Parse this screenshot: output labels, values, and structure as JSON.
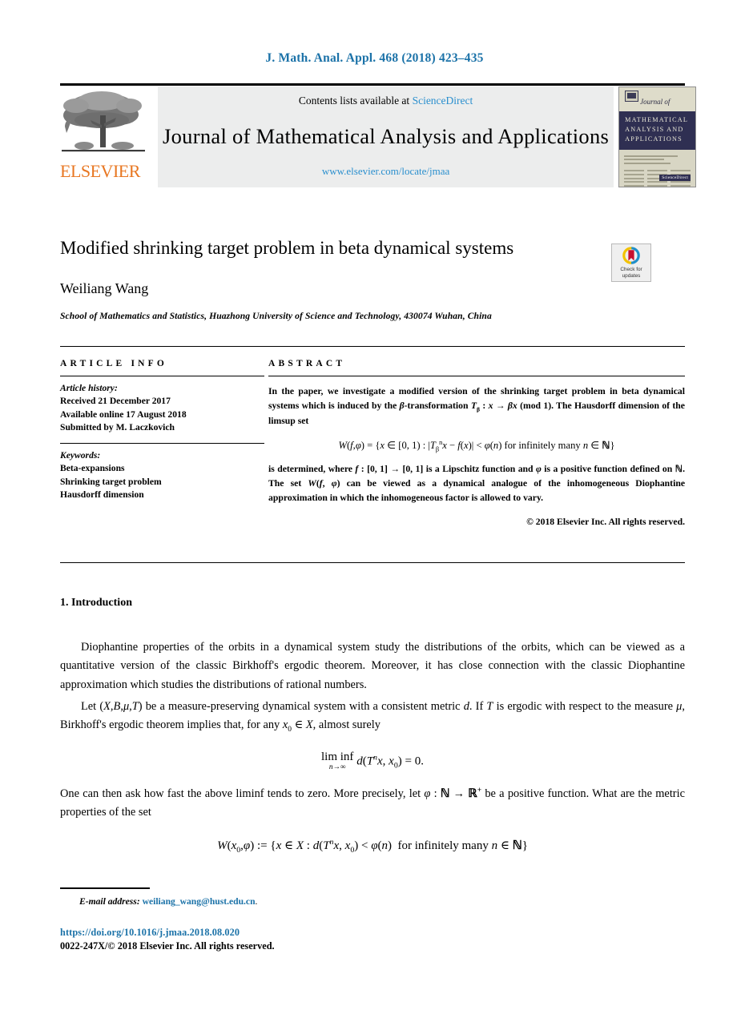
{
  "running_head": "J. Math. Anal. Appl. 468 (2018) 423–435",
  "masthead": {
    "contents_prefix": "Contents lists available at ",
    "sciencedirect": "ScienceDirect",
    "journal_title": "Journal of Mathematical Analysis and Applications",
    "journal_url": "www.elsevier.com/locate/jmaa",
    "publisher_wordmark": "ELSEVIER",
    "cover": {
      "script_line": "Journal of",
      "band_line1": "MATHEMATICAL",
      "band_line2": "ANALYSIS AND",
      "band_line3": "APPLICATIONS",
      "sd_badge": "ScienceDirect"
    },
    "link_color": "#2a8fce",
    "accent_color": "#e87722"
  },
  "article": {
    "title": "Modified shrinking target problem in beta dynamical systems",
    "author": "Weiliang Wang",
    "affiliation": "School of Mathematics and Statistics, Huazhong University of Science and Technology, 430074 Wuhan, China",
    "crossmark": {
      "line1": "Check for",
      "line2": "updates"
    }
  },
  "info": {
    "label": "ARTICLE INFO",
    "history_label": "Article history:",
    "history": [
      "Received 21 December 2017",
      "Available online 17 August 2018",
      "Submitted by M. Laczkovich"
    ],
    "keywords_label": "Keywords:",
    "keywords": [
      "Beta-expansions",
      "Shrinking target problem",
      "Hausdorff dimension"
    ]
  },
  "abstract": {
    "label": "ABSTRACT",
    "paragraph1": "In the paper, we investigate a modified version of the shrinking target problem in beta dynamical systems which is induced by the β-transformation Tβ : x → βx (mod 1). The Hausdorff dimension of the limsup set",
    "equation": "W(f,φ) = {x ∈ [0, 1) : |Tβⁿ x − f(x)| < φ(n) for infinitely many n ∈ ℕ}",
    "paragraph2": "is determined, where f : [0, 1] → [0, 1] is a Lipschitz function and φ is a positive function defined on ℕ. The set W(f, φ) can be viewed as a dynamical analogue of the inhomogeneous Diophantine approximation in which the inhomogeneous factor is allowed to vary.",
    "copyright": "© 2018 Elsevier Inc. All rights reserved."
  },
  "body": {
    "section_number": "1.",
    "section_title": "Introduction",
    "paragraph1": "Diophantine properties of the orbits in a dynamical system study the distributions of the orbits, which can be viewed as a quantitative version of the classic Birkhoff's ergodic theorem. Moreover, it has close connection with the classic Diophantine approximation which studies the distributions of rational numbers.",
    "paragraph2": "Let (X, B, μ, T) be a measure-preserving dynamical system with a consistent metric d. If T is ergodic with respect to the measure μ, Birkhoff's ergodic theorem implies that, for any x₀ ∈ X, almost surely",
    "equation1": "liminf_{n→∞} d(Tⁿx, x₀) = 0.",
    "paragraph3": "One can then ask how fast the above liminf tends to zero. More precisely, let φ : ℕ → ℝ⁺ be a positive function. What are the metric properties of the set",
    "equation2": "W(x₀, φ) := {x ∈ X : d(Tⁿx, x₀) < φ(n)  for infinitely many n ∈ ℕ}"
  },
  "footer": {
    "email_label": "E-mail address:",
    "email": "weiliang_wang@hust.edu.cn",
    "email_period": ".",
    "doi": "https://doi.org/10.1016/j.jmaa.2018.08.020",
    "issn": "0022-247X/© 2018 Elsevier Inc. All rights reserved."
  }
}
